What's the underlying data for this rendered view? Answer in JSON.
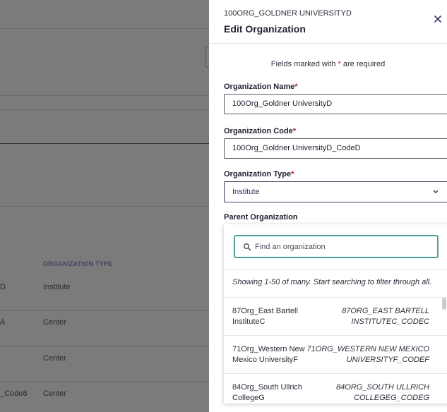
{
  "background": {
    "column_header": "ORGANIZATION TYPE",
    "rows": [
      {
        "code_fragment": "D",
        "type": "Institute"
      },
      {
        "code_fragment": "A",
        "type": "Center"
      },
      {
        "code_fragment": "",
        "type": "Center"
      },
      {
        "code_fragment": "_Code8",
        "type": "Center"
      }
    ]
  },
  "drawer": {
    "subtitle": "100ORG_GOLDNER UNIVERSITYD",
    "title": "Edit Organization",
    "close_icon": "close-icon",
    "required_note": {
      "before": "Fields marked with ",
      "star": "*",
      "after": " are required"
    },
    "fields": {
      "name": {
        "label": "Organization Name",
        "star": "*",
        "value": "100Org_Goldner UniversityD"
      },
      "code": {
        "label": "Organization Code",
        "star": "*",
        "value": "100Org_Goldner UniversityD_CodeD"
      },
      "type": {
        "label": "Organization Type",
        "star": "*",
        "value": "Institute",
        "icon": "chevron-down-icon"
      },
      "parent": {
        "label": "Parent Organization"
      }
    },
    "parent_dropdown": {
      "search_placeholder": "Find an organization",
      "search_icon": "search-icon",
      "showing_text": "Showing 1-50 of many. Start searching to filter through all.",
      "items": [
        {
          "name": "87Org_East Bartell InstituteC",
          "code": "87ORG_EAST BARTELL INSTITUTEC_CODEC"
        },
        {
          "name": "71Org_Western New Mexico UniversityF",
          "code": "71ORG_WESTERN NEW MEXICO UNIVERSITYF_CODEF"
        },
        {
          "name": "84Org_South Ullrich CollegeG",
          "code": "84ORG_SOUTH ULLRICH COLLEGEG_CODEG"
        }
      ]
    }
  },
  "colors": {
    "overlay": "#7b7b7b",
    "required_star": "#b11f1f",
    "focus_ring": "#4f9e9a",
    "link_navy": "#2e3560"
  }
}
